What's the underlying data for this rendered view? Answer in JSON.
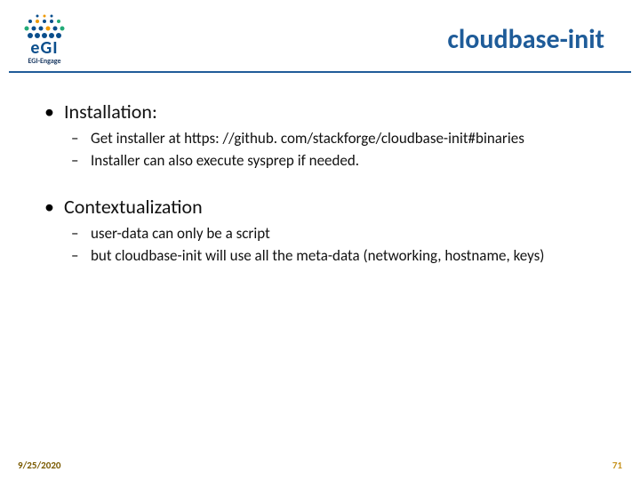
{
  "header": {
    "logo_main": "eGI",
    "logo_sub": "EGI-Engage",
    "title": "cloudbase-init"
  },
  "bullets": [
    {
      "label": "Installation:",
      "sub": [
        "Get installer at https: //github. com/stackforge/cloudbase-init#binaries",
        "Installer can also execute sysprep if needed."
      ]
    },
    {
      "label": "Contextualization",
      "sub": [
        "user-data can only be a script",
        "but cloudbase-init will use all the meta-data (networking, hostname, keys)"
      ]
    }
  ],
  "footer": {
    "date": "9/25/2020",
    "page": "71"
  }
}
